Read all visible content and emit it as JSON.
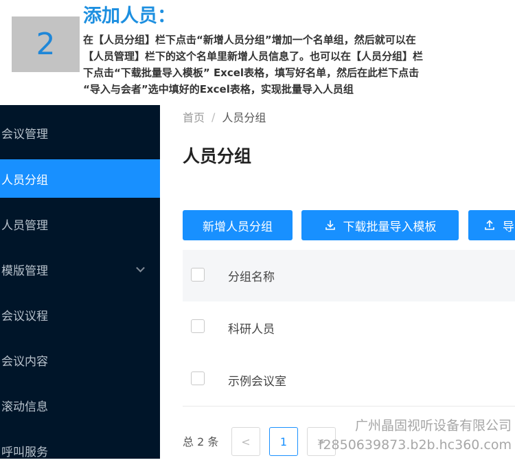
{
  "step": {
    "number": "2",
    "title": "添加人员：",
    "description": [
      "在【人员分组】栏下点击“新增人员分组”增加一个名单组，然后就可以在",
      "【人员管理】栏下的这个名单里新增人员信息了。也可以在【人员分组】栏",
      "下点击“下载批量导入模板” Excel表格，填写好名单，然后在此栏下点击",
      "“导入与会者”选中填好的Excel表格，实现批量导入人员组"
    ]
  },
  "sidebar": {
    "items": [
      {
        "label": "会议管理",
        "active": false
      },
      {
        "label": "人员分组",
        "active": true
      },
      {
        "label": "人员管理",
        "active": false
      },
      {
        "label": "模版管理",
        "active": false,
        "has_submenu": true
      },
      {
        "label": "会议议程",
        "active": false
      },
      {
        "label": "会议内容",
        "active": false
      },
      {
        "label": "滚动信息",
        "active": false
      },
      {
        "label": "呼叫服务",
        "active": false
      }
    ]
  },
  "breadcrumb": {
    "home": "首页",
    "separator": "/",
    "current": "人员分组"
  },
  "page_title": "人员分组",
  "toolbar": {
    "add_group_label": "新增人员分组",
    "download_template_label": "下载批量导入模板",
    "import_label": "导"
  },
  "table": {
    "header": {
      "group_name": "分组名称"
    },
    "rows": [
      {
        "group_name": "科研人员"
      },
      {
        "group_name": "示例会议室"
      }
    ]
  },
  "pagination": {
    "total_text": "总 2 条",
    "current_page": "1",
    "prev_symbol": "<",
    "next_symbol": ">"
  },
  "watermark": {
    "line1": "广州晶固视听设备有限公司",
    "line2": "f2850639873.b2b.hc360.com"
  },
  "colors": {
    "accent": "#1890ff",
    "sidebar_bg": "#001529",
    "title_blue": "#1d8fe0",
    "step_box": "#c3c3c3"
  }
}
